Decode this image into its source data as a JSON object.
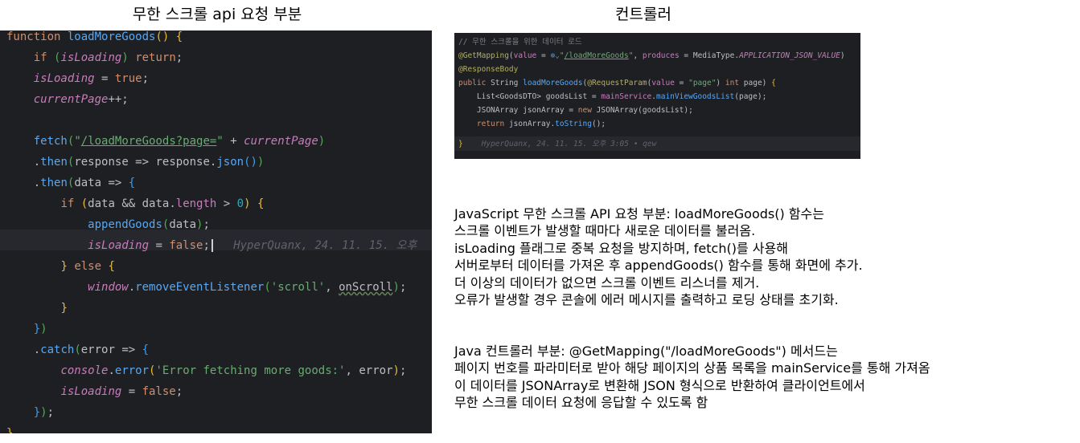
{
  "headings": {
    "left": "무한 스크롤 api 요청 부분",
    "right": "컨트롤러"
  },
  "js_code": {
    "tokens": {
      "function_kw": "function",
      "func_name": "loadMoreGoods",
      "parens_open": "() {",
      "if_kw": "if",
      "isLoading": "isLoading",
      "return_kw": "return",
      "true_kw": "true",
      "false_kw": "false",
      "currentPage": "currentPage",
      "plusplus": "++;",
      "fetch": "fetch",
      "fetch_url": "/loadMoreGoods?page=",
      "then": "then",
      "response": "response",
      "json": "json",
      "data": "data",
      "length": "length",
      "zero": "0",
      "appendGoods": "appendGoods",
      "else_kw": "else",
      "window": "window",
      "removeEventListener": "removeEventListener",
      "scroll_str": "'scroll'",
      "onScroll": "onScroll",
      "catch": "catch",
      "error": "error",
      "console": "console",
      "error_msg": "'Error fetching more goods:'",
      "inlay_blame": "HyperQuanx, 24. 11. 15. 오후"
    }
  },
  "java_code": {
    "comment": "// 무한 스크롤을 위한 데이터 로드",
    "getmapping": "@GetMapping",
    "value_kw": "value",
    "mapping_url": "/loadMoreGoods",
    "produces": "produces",
    "mediatype": "MediaType",
    "json_value": "APPLICATION_JSON_VALUE",
    "responsebody": "@ResponseBody",
    "public_kw": "public",
    "string_type": "String",
    "method_name": "loadMoreGoods",
    "requestparam": "@RequestParam",
    "page_str": "\"page\"",
    "int_kw": "int",
    "page": "page",
    "list_type": "List<GoodsDTO>",
    "goodsList": "goodsList",
    "mainService": "mainService",
    "mainViewGoodsList": "mainViewGoodsList",
    "jsonarray_type": "JSONArray",
    "jsonArray": "jsonArray",
    "new_kw": "new",
    "return_kw": "return",
    "toString": "toString",
    "blame": "HyperQuanx, 24. 11. 15. 오후 3:05 • qew"
  },
  "description_js": [
    "JavaScript 무한 스크롤 API 요청 부분: loadMoreGoods() 함수는",
    "스크롤 이벤트가 발생할 때마다 새로운 데이터를 불러옴.",
    "isLoading 플래그로 중복 요청을 방지하며, fetch()를 사용해",
    "서버로부터 데이터를 가져온 후 appendGoods() 함수를 통해 화면에 추가.",
    "더 이상의 데이터가 없으면 스크롤 이벤트 리스너를 제거.",
    "오류가 발생할 경우 콘솔에 에러 메시지를 출력하고 로딩 상태를 초기화."
  ],
  "description_java": [
    "Java 컨트롤러 부분: @GetMapping(\"/loadMoreGoods\") 메서드는",
    "페이지 번호를 파라미터로 받아 해당 페이지의 상품 목록을 mainService를 통해 가져옴",
    "이 데이터를 JSONArray로 변환해 JSON 형식으로 반환하여 클라이언트에서",
    "무한 스크롤 데이터 요청에 응답할 수 있도록 함"
  ],
  "colors": {
    "editor_bg": "#1e1f22",
    "keyword": "#cf8e6d",
    "function": "#56a8f5",
    "string": "#6aab73",
    "variable": "#c77dbb"
  }
}
